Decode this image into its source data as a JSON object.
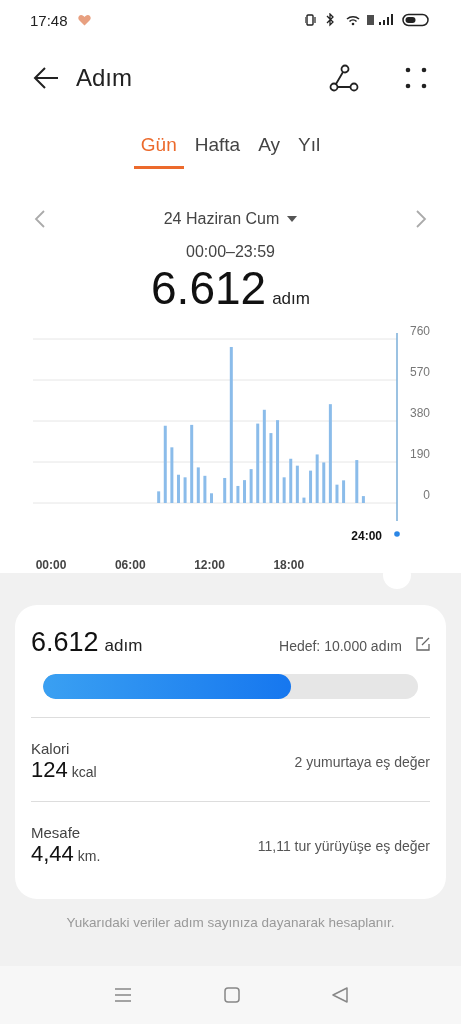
{
  "status_bar": {
    "time": "17:48"
  },
  "header": {
    "title": "Adım"
  },
  "tabs": [
    {
      "label": "Gün",
      "selected": true
    },
    {
      "label": "Hafta",
      "selected": false
    },
    {
      "label": "Ay",
      "selected": false
    },
    {
      "label": "Yıl",
      "selected": false
    }
  ],
  "date_nav": {
    "date": "24 Haziran Cum",
    "time_range": "00:00–23:59",
    "total": "6.612",
    "unit": "adım"
  },
  "chart_data": {
    "type": "bar",
    "x": [
      8,
      8.5,
      9,
      9.5,
      10,
      10.5,
      11,
      11.5,
      12,
      13,
      13.5,
      14,
      14.5,
      15,
      15.5,
      16,
      16.5,
      17,
      17.5,
      18,
      18.5,
      19,
      19.5,
      20,
      20.5,
      21,
      21.5,
      22,
      23,
      23.5
    ],
    "values": [
      54,
      358,
      258,
      131,
      119,
      362,
      165,
      126,
      45,
      116,
      723,
      79,
      106,
      157,
      368,
      432,
      324,
      384,
      119,
      205,
      173,
      25,
      150,
      225,
      188,
      458,
      85,
      105,
      199,
      32
    ],
    "xlim": [
      0,
      24
    ],
    "ylim": [
      0,
      760
    ],
    "xticks": [
      {
        "value": 0,
        "label": "00:00"
      },
      {
        "value": 6,
        "label": "06:00"
      },
      {
        "value": 12,
        "label": "12:00"
      },
      {
        "value": 18,
        "label": "18:00"
      }
    ],
    "yticks": [
      0,
      190,
      380,
      570,
      760
    ],
    "grid": true
  },
  "chart_cursor": {
    "time": "24:00"
  },
  "summary": {
    "steps": "6.612",
    "steps_unit": "adım",
    "goal": "Hedef: 10.000 adım",
    "level": 0.6612
  },
  "metrics": [
    {
      "label": "Kalori",
      "value": "124",
      "unit": "kcal",
      "equivalent": "2 yumurtaya eş değer"
    },
    {
      "label": "Mesafe",
      "value": "4,44",
      "unit": "km.",
      "equivalent": "11,11 tur yürüyüşe eş değer"
    }
  ],
  "footnote": "Yukarıdaki veriler adım sayınıza dayanarak hesaplanır."
}
